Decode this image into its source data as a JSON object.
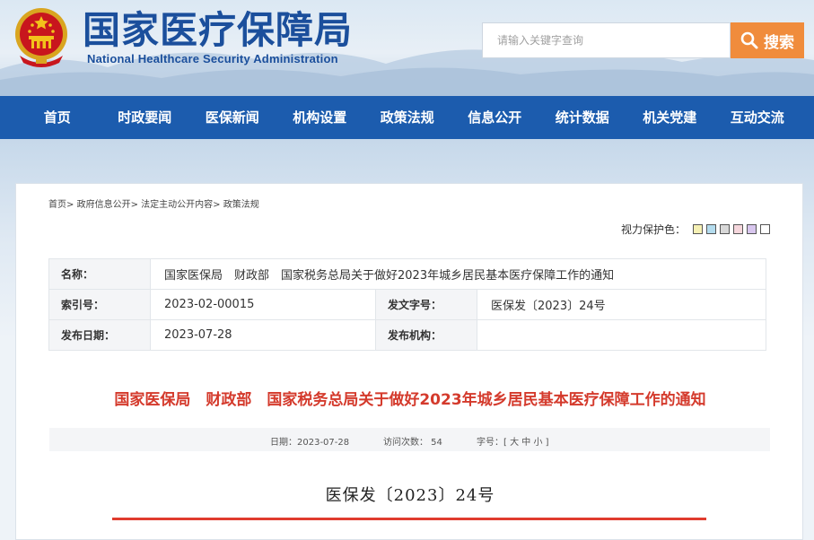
{
  "header": {
    "title": "国家医疗保障局",
    "subtitle": "National Healthcare Security Administration",
    "emblem_icon": "national-emblem",
    "search": {
      "placeholder": "请输入关键字查询",
      "button_label": "搜索",
      "icon": "search-icon"
    }
  },
  "colors": {
    "brand_blue": "#1c5cae",
    "search_orange": "#f08c3c",
    "title_red": "#d43a2c"
  },
  "nav": {
    "items": [
      "首页",
      "时政要闻",
      "医保新闻",
      "机构设置",
      "政策法规",
      "信息公开",
      "统计数据",
      "机关党建",
      "互动交流"
    ]
  },
  "breadcrumb": [
    "首页>",
    "政府信息公开>",
    "法定主动公开内容>",
    "政策法规"
  ],
  "eye_care": {
    "label": "视力保护色：",
    "swatches": [
      "#f5f0b4",
      "#b4dcee",
      "#d8d8d8",
      "#f5d6dc",
      "#d8c6ee",
      "#ffffff"
    ]
  },
  "info": {
    "name_label": "名称：",
    "name_value": "国家医保局　财政部　国家税务总局关于做好2023年城乡居民基本医疗保障工作的通知",
    "index_label": "索引号：",
    "index_value": "2023-02-00015",
    "docno_label": "发文字号：",
    "docno_value": "医保发〔2023〕24号",
    "date_label": "发布日期：",
    "date_value": "2023-07-28",
    "org_label": "发布机构：",
    "org_value": ""
  },
  "article": {
    "title": "国家医保局　财政部　国家税务总局关于做好2023年城乡居民基本医疗保障工作的通知",
    "meta_date": "日期：2023-07-28",
    "meta_views": "访问次数：  54",
    "meta_font_label": "字号：[",
    "font_large": "大",
    "font_medium": "中",
    "font_small": "小",
    "meta_font_close": "]",
    "doc_number": "医保发〔2023〕24号"
  }
}
